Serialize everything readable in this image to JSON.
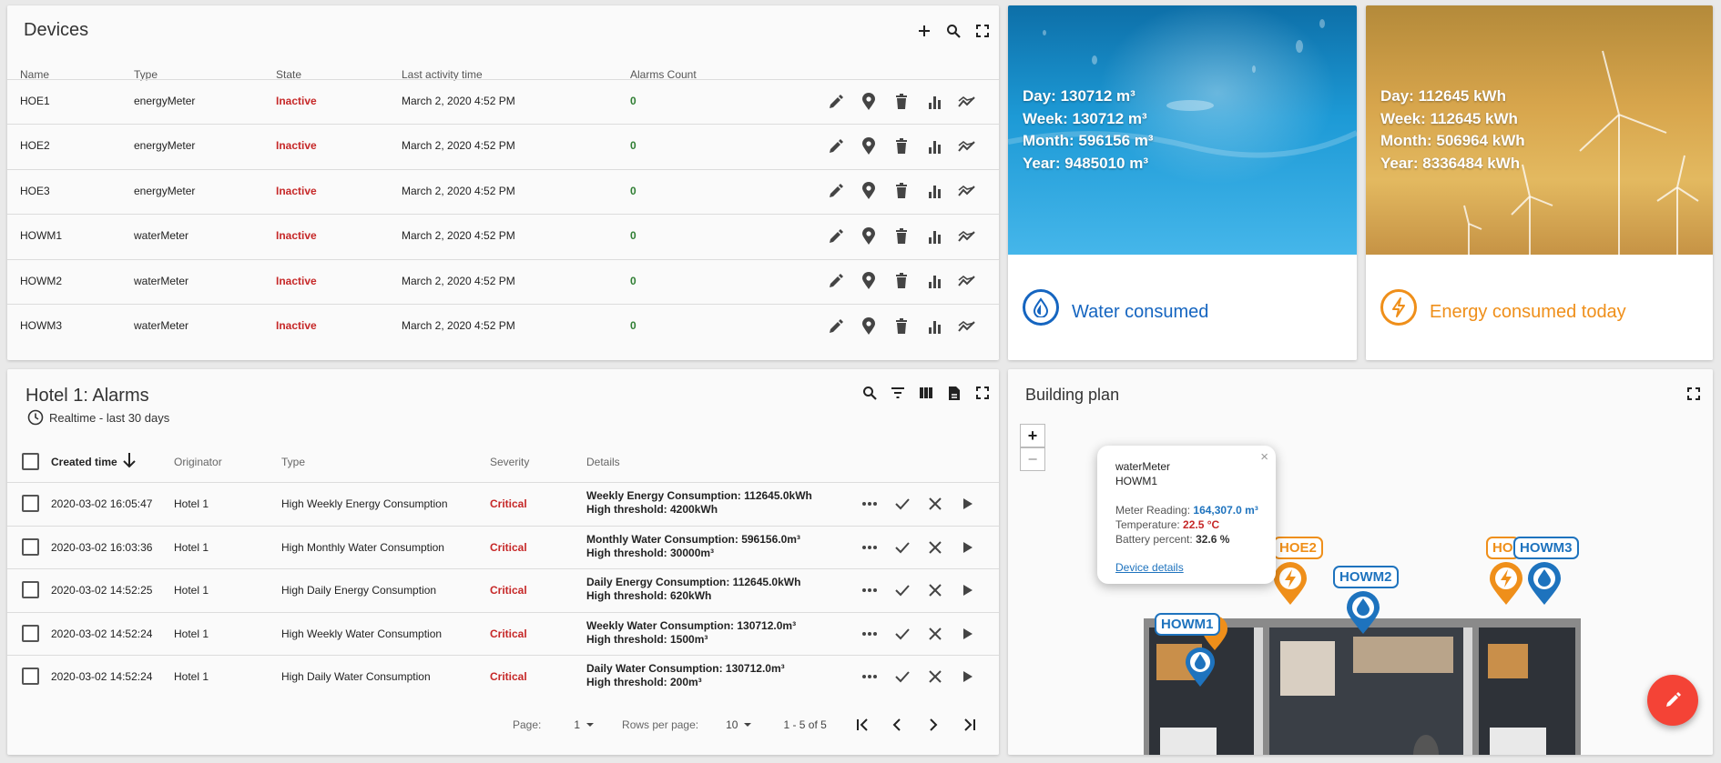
{
  "devices": {
    "title": "Devices",
    "columns": [
      "Name",
      "Type",
      "State",
      "Last activity time",
      "Alarms Count"
    ],
    "rows": [
      {
        "name": "HOE1",
        "type": "energyMeter",
        "state": "Inactive",
        "last": "March 2, 2020 4:52 PM",
        "alarms": "0"
      },
      {
        "name": "HOE2",
        "type": "energyMeter",
        "state": "Inactive",
        "last": "March 2, 2020 4:52 PM",
        "alarms": "0"
      },
      {
        "name": "HOE3",
        "type": "energyMeter",
        "state": "Inactive",
        "last": "March 2, 2020 4:52 PM",
        "alarms": "0"
      },
      {
        "name": "HOWM1",
        "type": "waterMeter",
        "state": "Inactive",
        "last": "March 2, 2020 4:52 PM",
        "alarms": "0"
      },
      {
        "name": "HOWM2",
        "type": "waterMeter",
        "state": "Inactive",
        "last": "March 2, 2020 4:52 PM",
        "alarms": "0"
      },
      {
        "name": "HOWM3",
        "type": "waterMeter",
        "state": "Inactive",
        "last": "March 2, 2020 4:52 PM",
        "alarms": "0"
      }
    ]
  },
  "water": {
    "day": "Day: 130712 m³",
    "week": "Week: 130712 m³",
    "month": "Month: 596156 m³",
    "year": "Year: 9485010 m³",
    "label": "Water consumed",
    "color": "#1565c0"
  },
  "energy": {
    "day": "Day: 112645 kWh",
    "week": "Week: 112645 kWh",
    "month": "Month: 506964 kWh",
    "year": "Year: 8336484 kWh",
    "label": "Energy consumed today",
    "color": "#ef8f1a"
  },
  "alarms": {
    "title": "Hotel 1: Alarms",
    "subtitle": "Realtime - last 30 days",
    "columns": {
      "created": "Created time",
      "originator": "Originator",
      "type": "Type",
      "severity": "Severity",
      "details": "Details"
    },
    "rows": [
      {
        "time": "2020-03-02 16:05:47",
        "originator": "Hotel 1",
        "type": "High Weekly Energy Consumption",
        "severity": "Critical",
        "d1": "Weekly Energy Consumption: 112645.0kWh",
        "d2": "High threshold: 4200kWh"
      },
      {
        "time": "2020-03-02 16:03:36",
        "originator": "Hotel 1",
        "type": "High Monthly Water Consumption",
        "severity": "Critical",
        "d1": "Monthly Water Consumption: 596156.0m³",
        "d2": "High threshold: 30000m³"
      },
      {
        "time": "2020-03-02 14:52:25",
        "originator": "Hotel 1",
        "type": "High Daily Energy Consumption",
        "severity": "Critical",
        "d1": "Daily Energy Consumption: 112645.0kWh",
        "d2": "High threshold: 620kWh"
      },
      {
        "time": "2020-03-02 14:52:24",
        "originator": "Hotel 1",
        "type": "High Weekly Water Consumption",
        "severity": "Critical",
        "d1": "Weekly Water Consumption: 130712.0m³",
        "d2": "High threshold: 1500m³"
      },
      {
        "time": "2020-03-02 14:52:24",
        "originator": "Hotel 1",
        "type": "High Daily Water Consumption",
        "severity": "Critical",
        "d1": "Daily Water Consumption: 130712.0m³",
        "d2": "High threshold: 200m³"
      }
    ],
    "pager": {
      "page_label": "Page:",
      "page": "1",
      "rows_label": "Rows per page:",
      "rows": "10",
      "range": "1 - 5 of 5"
    }
  },
  "building": {
    "title": "Building plan",
    "popup": {
      "type": "waterMeter",
      "name": "HOWM1",
      "reading_label": "Meter Reading:",
      "reading": "164,307.0 m³",
      "temp_label": "Temperature:",
      "temp": "22.5 °C",
      "battery_label": "Battery percent:",
      "battery": "32.6 %",
      "link": "Device details"
    },
    "markers": {
      "howm1": "HOWM1",
      "hoe2": "HOE2",
      "howm2": "HOWM2",
      "hoe3": "HO",
      "howm3": "HOWM3"
    },
    "zoom_in": "+",
    "zoom_out": "−"
  }
}
